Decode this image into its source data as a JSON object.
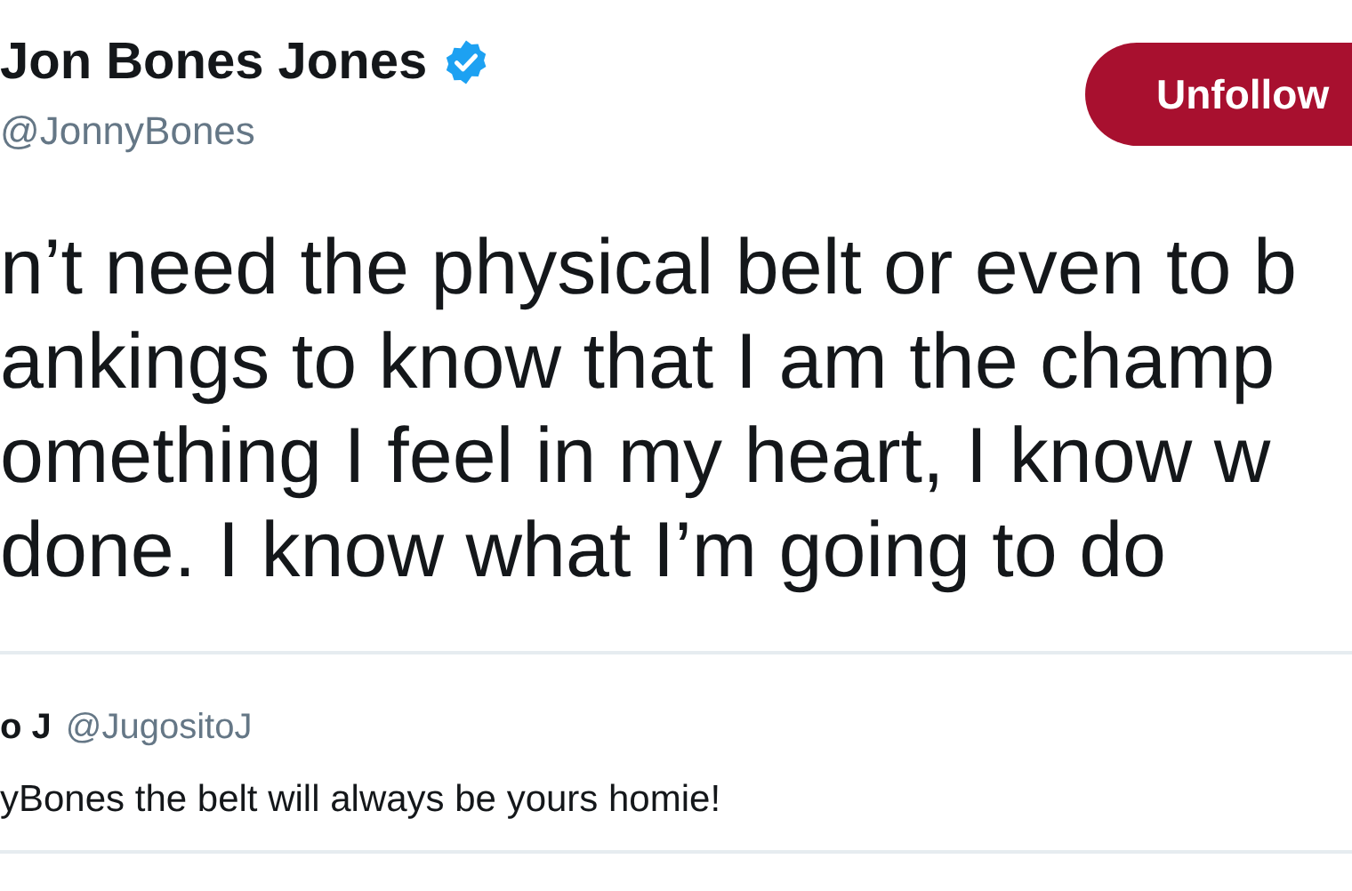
{
  "author": {
    "name": "Jon Bones Jones",
    "verified": true,
    "handle": "@JonnyBones"
  },
  "follow_button": {
    "label": "Unfollow"
  },
  "tweet_lines": [
    "n’t need the physical belt or even to b",
    "ankings to know that I am the champ",
    "omething I feel in my heart, I know w",
    "done. I know what I’m going to do"
  ],
  "quoted_tweet": {
    "name": "o J",
    "handle": "@JugositoJ",
    "text": "yBones the belt will always be yours homie!"
  }
}
